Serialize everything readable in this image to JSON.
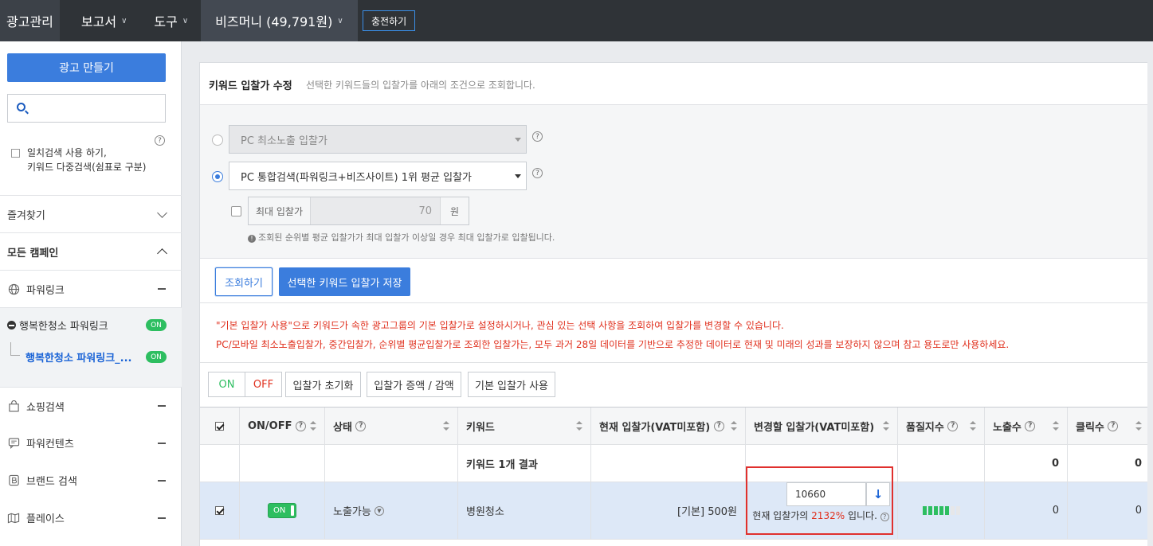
{
  "topnav": {
    "ad_manage": "광고관리",
    "report": "보고서",
    "tools": "도구",
    "bizmoney": "비즈머니 (49,791원)",
    "charge": "충전하기"
  },
  "sidebar": {
    "create_ad": "광고 만들기",
    "search_placeholder": "",
    "exact_match_line1": "일치검색 사용 하기,",
    "exact_match_line2": "키워드 다중검색(쉼표로 구분)",
    "help": "?",
    "favorites": "즐겨찾기",
    "all_campaigns": "모든 캠페인",
    "items": [
      {
        "label": "파워링크"
      },
      {
        "label": "행복한청소 파워링크",
        "badge": "ON"
      },
      {
        "label": "행복한청소 파워링크_...",
        "badge": "ON"
      },
      {
        "label": "쇼핑검색"
      },
      {
        "label": "파워컨텐츠"
      },
      {
        "label": "브랜드 검색"
      },
      {
        "label": "플레이스"
      }
    ]
  },
  "panel": {
    "title": "키워드 입찰가 수정",
    "desc": "선택한 키워드들의 입찰가를 아래의 조건으로 조회합니다.",
    "option1": "PC 최소노출 입찰가",
    "option2": "PC 통합검색(파워링크+비즈사이트) 1위 평균 입찰가",
    "maxbid_label": "최대 입찰가",
    "maxbid_value": "70",
    "maxbid_unit": "원",
    "note": "조회된 순위별 평균 입찰가가 최대 입찰가 이상일 경우 최대 입찰가로 입찰됩니다.",
    "btn_search": "조회하기",
    "btn_save": "선택한 키워드 입찰가 저장",
    "warn1": "\"기본 입찰가 사용\"으로 키워드가 속한 광고그룹의 기본 입찰가로 설정하시거나, 관심 있는 선택 사항을 조회하여 입찰가를 변경할 수 있습니다.",
    "warn2": "PC/모바일 최소노출입찰가, 중간입찰가, 순위별 평균입찰가로 조회한 입찰가는, 모두 과거 28일 데이터를 기반으로 추정한 데이터로 현재 및 미래의 성과를 보장하지 않으며 참고 용도로만 사용하세요.",
    "tb_on": "ON",
    "tb_off": "OFF",
    "tb_reset": "입찰가 초기화",
    "tb_adjust": "입찰가 증액 / 감액",
    "tb_default": "기본 입찰가 사용"
  },
  "table": {
    "headers": {
      "onoff": "ON/OFF",
      "status": "상태",
      "keyword": "키워드",
      "current_bid": "현재 입찰가(VAT미포함)",
      "new_bid": "변경할 입찰가(VAT미포함)",
      "quality": "품질지수",
      "impressions": "노출수",
      "clicks": "클릭수"
    },
    "summary": {
      "keyword": "키워드 1개 결과",
      "impressions": "0",
      "clicks": "0"
    },
    "row": {
      "switch": "ON",
      "status": "노출가능",
      "keyword": "병원청소",
      "current_bid": "[기본] 500원",
      "new_bid": "10660",
      "bid_text_prefix": "현재 입찰가의",
      "bid_pct": "2132%",
      "bid_text_suffix": "입니다.",
      "quality_filled": 5,
      "quality_total": 7,
      "impressions": "0",
      "clicks": "0"
    }
  }
}
